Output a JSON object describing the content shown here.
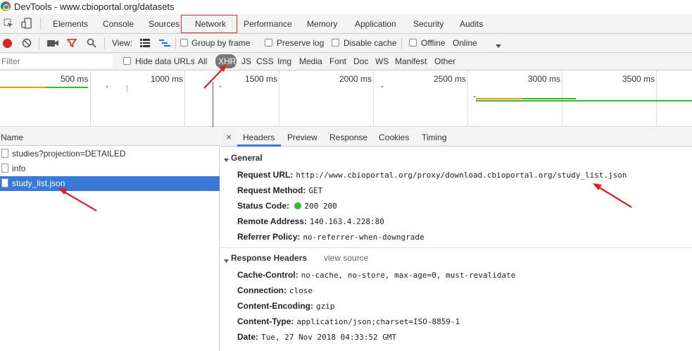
{
  "window": {
    "title": "DevTools - www.cbioportal.org/datasets"
  },
  "tabs": [
    "Elements",
    "Console",
    "Sources",
    "Network",
    "Performance",
    "Memory",
    "Application",
    "Security",
    "Audits"
  ],
  "toolbar": {
    "view_label": "View:",
    "group_by_frame": "Group by frame",
    "preserve_log": "Preserve log",
    "disable_cache": "Disable cache",
    "offline": "Offline",
    "throttle_value": "Online"
  },
  "filterbar": {
    "filter_placeholder": "Filter",
    "hide_data_urls": "Hide data URLs",
    "types": [
      "All",
      "XHR",
      "JS",
      "CSS",
      "Img",
      "Media",
      "Font",
      "Doc",
      "WS",
      "Manifest",
      "Other"
    ],
    "active_type": "XHR"
  },
  "timeline": {
    "ticks": [
      "500 ms",
      "1000 ms",
      "1500 ms",
      "2000 ms",
      "2500 ms",
      "3000 ms",
      "3500 ms"
    ]
  },
  "requests": {
    "column_header": "Name",
    "rows": [
      {
        "name": "studies?projection=DETAILED",
        "selected": false
      },
      {
        "name": "info",
        "selected": false
      },
      {
        "name": "study_list.json",
        "selected": true
      }
    ]
  },
  "details": {
    "close_label": "×",
    "tabs": [
      "Headers",
      "Preview",
      "Response",
      "Cookies",
      "Timing"
    ],
    "active_tab": "Headers",
    "general": {
      "title": "General",
      "fields": [
        {
          "key": "Request URL:",
          "value": "http://www.cbioportal.org/proxy/download.cbioportal.org/study_list.json"
        },
        {
          "key": "Request Method:",
          "value": "GET"
        },
        {
          "key": "Status Code:",
          "value": "200 200"
        },
        {
          "key": "Remote Address:",
          "value": "140.163.4.228:80"
        },
        {
          "key": "Referrer Policy:",
          "value": "no-referrer-when-downgrade"
        }
      ]
    },
    "response_headers": {
      "title": "Response Headers",
      "view_source": "view source",
      "fields": [
        {
          "key": "Cache-Control:",
          "value": "no-cache, no-store, max-age=0, must-revalidate"
        },
        {
          "key": "Connection:",
          "value": "close"
        },
        {
          "key": "Content-Encoding:",
          "value": "gzip"
        },
        {
          "key": "Content-Type:",
          "value": "application/json;charset=ISO-8859-1"
        },
        {
          "key": "Date:",
          "value": "Tue, 27 Nov 2018 04:33:52 GMT"
        }
      ]
    }
  },
  "colors": {
    "accent": "#3879d9",
    "annotation": "#e02020",
    "status_ok": "#2dbe2d"
  }
}
